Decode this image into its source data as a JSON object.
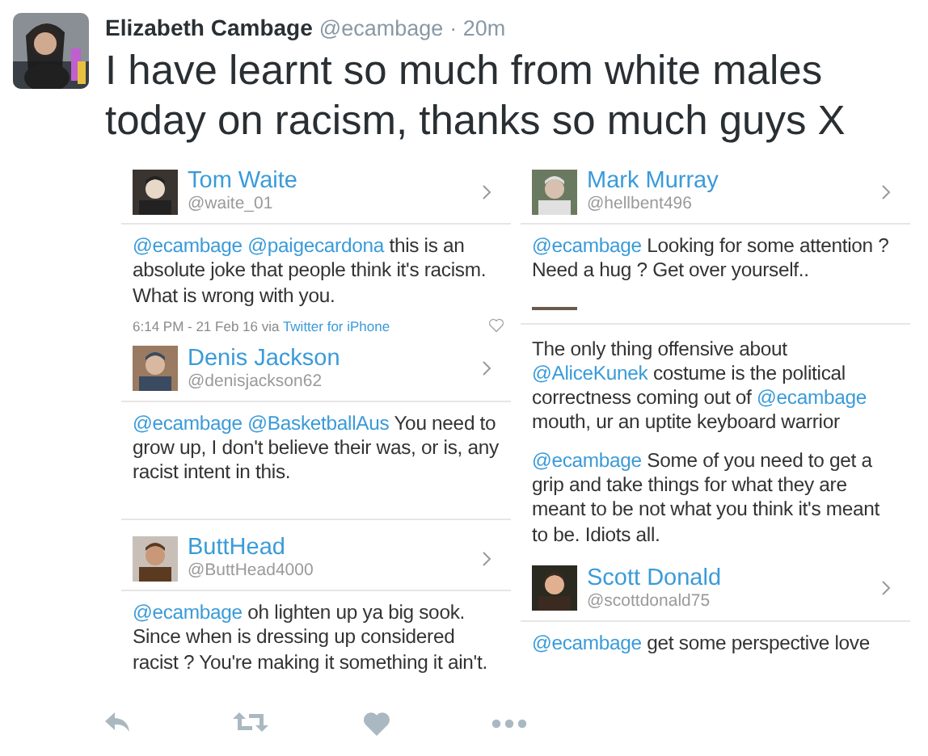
{
  "tweet": {
    "name": "Elizabeth Cambage",
    "handle": "@ecambage",
    "time": "· 20m",
    "text": "I have learnt so much from white males today on racism, thanks so much guys X"
  },
  "collage": {
    "columns": [
      [
        {
          "kind": "profile",
          "name": "Tom Waite",
          "handle": "@waite_01"
        },
        {
          "kind": "body",
          "parts": [
            {
              "text": "@ecambage @paigecardona",
              "mention": true
            },
            {
              "text": " this is an absolute joke that people think it's racism. What is wrong with you.",
              "mention": false
            }
          ]
        },
        {
          "kind": "meta",
          "time": "6:14 PM - 21 Feb 16 via",
          "source": "Twitter for iPhone"
        },
        {
          "kind": "profile",
          "name": "Denis Jackson",
          "handle": "@denisjackson62"
        },
        {
          "kind": "body",
          "parts": [
            {
              "text": "@ecambage @BasketballAus",
              "mention": true
            },
            {
              "text": " You need to grow up, I don't believe their was, or is, any racist intent in this.",
              "mention": false
            }
          ]
        },
        {
          "kind": "gap"
        },
        {
          "kind": "profile",
          "name": "ButtHead",
          "handle": "@ButtHead4000"
        },
        {
          "kind": "body",
          "parts": [
            {
              "text": "@ecambage",
              "mention": true
            },
            {
              "text": " oh lighten up ya big sook. Since when is dressing up considered racist ? You're making it something it ain't.",
              "mention": false
            }
          ]
        }
      ],
      [
        {
          "kind": "profile",
          "name": "Mark Murray",
          "handle": "@hellbent496"
        },
        {
          "kind": "body",
          "parts": [
            {
              "text": "@ecambage",
              "mention": true
            },
            {
              "text": "  Looking for some attention ? Need a hug ? Get over yourself..",
              "mention": false
            }
          ]
        },
        {
          "kind": "strip"
        },
        {
          "kind": "body",
          "parts": [
            {
              "text": "The only thing offensive about ",
              "mention": false
            },
            {
              "text": "@AliceKunek",
              "mention": true
            },
            {
              "text": " costume is the political correctness coming out of ",
              "mention": false
            },
            {
              "text": "@ecambage",
              "mention": true
            },
            {
              "text": " mouth, ur an uptite keyboard warrior",
              "mention": false
            }
          ]
        },
        {
          "kind": "body",
          "parts": [
            {
              "text": "@ecambage",
              "mention": true
            },
            {
              "text": " Some of you need to get a grip and take things for what they are meant to be not what you think it's meant to be. Idiots all.",
              "mention": false
            }
          ]
        },
        {
          "kind": "profile",
          "name": "Scott Donald",
          "handle": "@scottdonald75"
        },
        {
          "kind": "body",
          "parts": [
            {
              "text": "@ecambage",
              "mention": true
            },
            {
              "text": " get some perspective love",
              "mention": false
            }
          ]
        }
      ]
    ]
  },
  "actions": [
    {
      "kind": "reply"
    },
    {
      "kind": "retweet"
    },
    {
      "kind": "like"
    },
    {
      "kind": "more"
    }
  ]
}
